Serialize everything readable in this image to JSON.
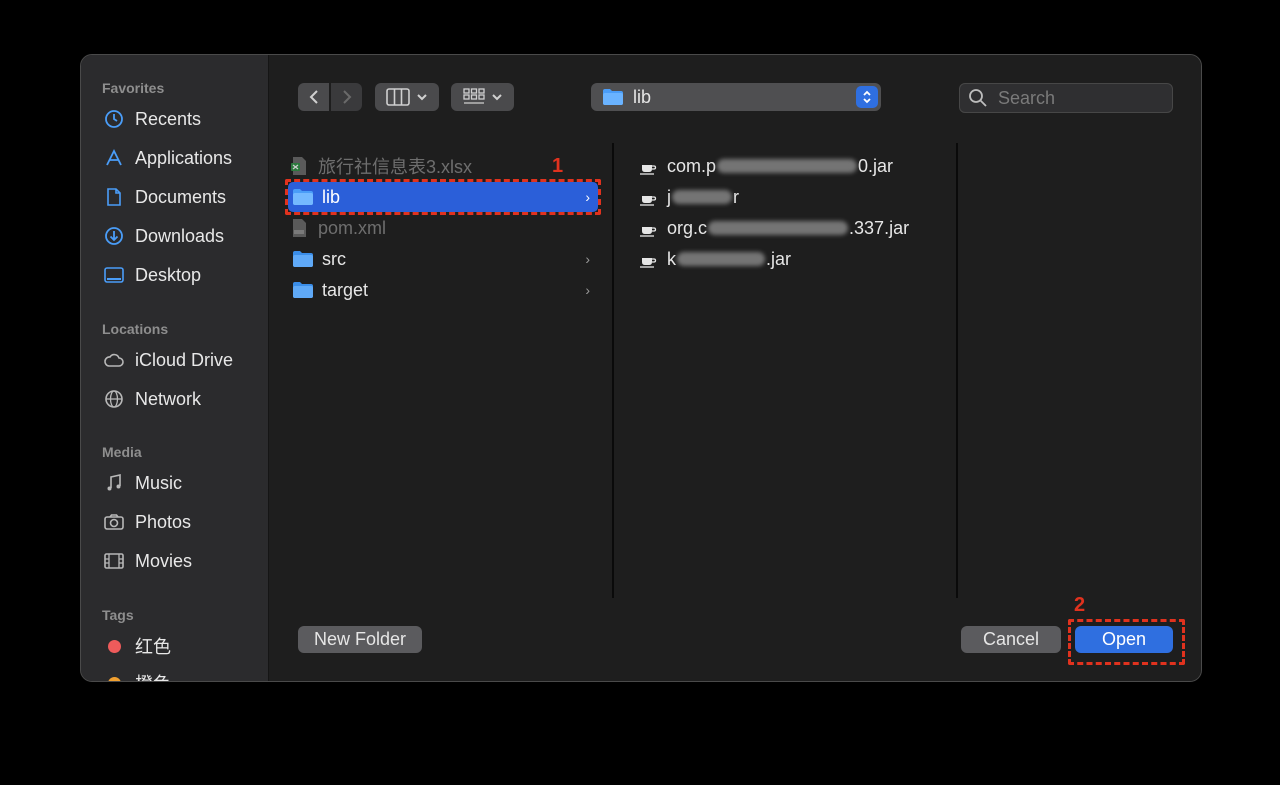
{
  "sidebar": {
    "favorites_heading": "Favorites",
    "favorites": [
      {
        "label": "Recents",
        "icon": "clock-icon"
      },
      {
        "label": "Applications",
        "icon": "applications-icon"
      },
      {
        "label": "Documents",
        "icon": "document-icon"
      },
      {
        "label": "Downloads",
        "icon": "download-icon"
      },
      {
        "label": "Desktop",
        "icon": "desktop-icon"
      }
    ],
    "locations_heading": "Locations",
    "locations": [
      {
        "label": "iCloud Drive",
        "icon": "cloud-icon"
      },
      {
        "label": "Network",
        "icon": "globe-icon"
      }
    ],
    "media_heading": "Media",
    "media": [
      {
        "label": "Music",
        "icon": "music-note-icon"
      },
      {
        "label": "Photos",
        "icon": "camera-icon"
      },
      {
        "label": "Movies",
        "icon": "film-icon"
      }
    ],
    "tags_heading": "Tags",
    "tags": [
      {
        "label": "红色",
        "color": "#ee5b5b"
      },
      {
        "label": "橙色",
        "color": "#f0a030"
      }
    ]
  },
  "toolbar": {
    "path_label": "lib",
    "search_placeholder": "Search"
  },
  "column1": [
    {
      "name": "旅行社信息表3.xlsx",
      "kind": "xlsx",
      "dim": true
    },
    {
      "name": "lib",
      "kind": "folder",
      "selected": true
    },
    {
      "name": "pom.xml",
      "kind": "xml",
      "dim": true
    },
    {
      "name": "src",
      "kind": "folder"
    },
    {
      "name": "target",
      "kind": "folder"
    }
  ],
  "column2": [
    {
      "prefix": "com.p",
      "suffix": "0.jar"
    },
    {
      "prefix": "j",
      "suffix": "r"
    },
    {
      "prefix": "org.c",
      "suffix": ".337.jar"
    },
    {
      "prefix": "k",
      "suffix": ".jar"
    }
  ],
  "annotations": {
    "one": "1",
    "two": "2"
  },
  "buttons": {
    "new_folder": "New Folder",
    "cancel": "Cancel",
    "open": "Open"
  },
  "colors": {
    "accent": "#2f6fe0",
    "annotation": "#e0321e"
  }
}
